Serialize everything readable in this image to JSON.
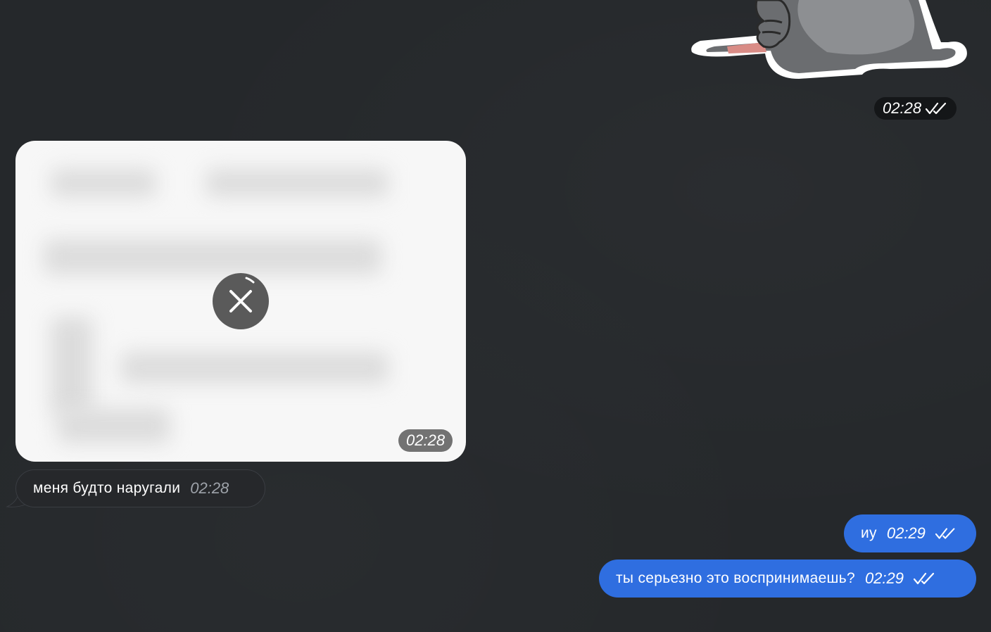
{
  "sticker": {
    "time": "02:28",
    "status": "read"
  },
  "photo_message": {
    "time": "02:28",
    "state": "loading"
  },
  "incoming_message": {
    "text": "меня будто наругали",
    "time": "02:28"
  },
  "outgoing_messages": [
    {
      "text": "иу",
      "time": "02:29",
      "status": "read"
    },
    {
      "text": "ты серьезно это воспринимаешь?",
      "time": "02:29",
      "status": "read"
    }
  ],
  "colors": {
    "background": "#25282b",
    "outgoing_bubble": "#2f6ee0",
    "incoming_bubble": "#26282b",
    "incoming_border": "#3a3d42",
    "time_pill": "#141618"
  },
  "icons": [
    "double-check-icon",
    "cancel-download-icon"
  ]
}
